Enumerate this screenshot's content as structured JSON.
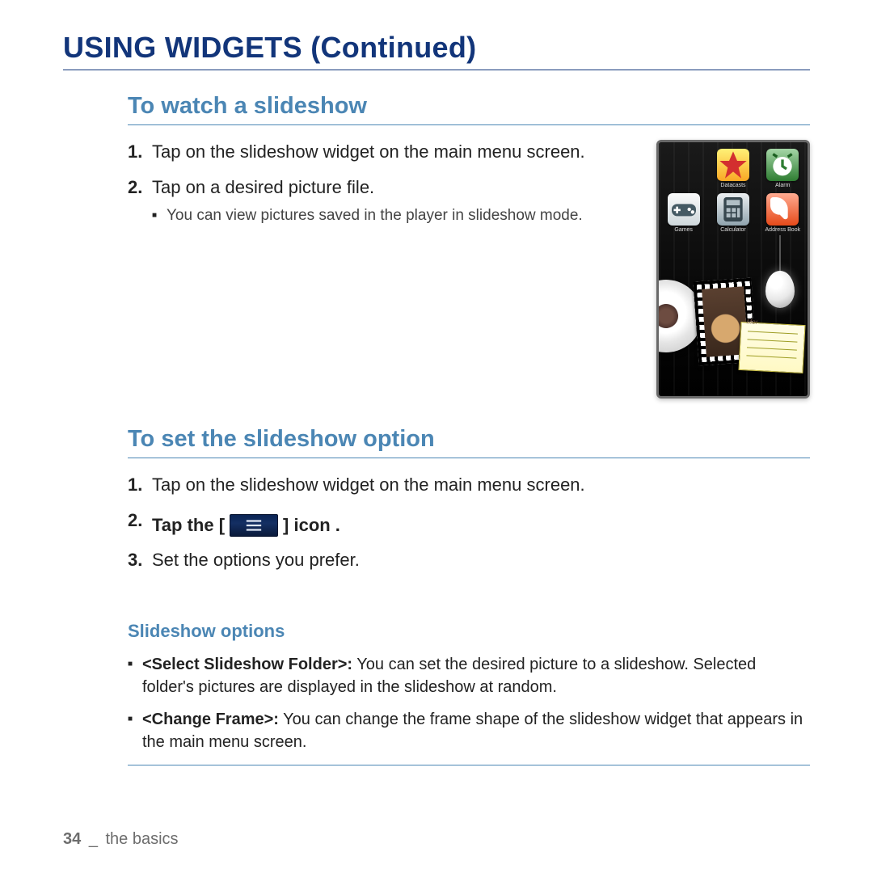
{
  "page_title": "USING WIDGETS (Continued)",
  "section1": {
    "title": "To watch a slideshow",
    "steps": [
      {
        "text": "Tap on the slideshow widget on the main menu screen."
      },
      {
        "text": "Tap on a desired picture file.",
        "sub": [
          "You can view pictures saved in the player in slideshow mode."
        ]
      }
    ]
  },
  "device": {
    "apps": [
      {
        "id": "star",
        "label": "Datacasts"
      },
      {
        "id": "alarm",
        "label": "Alarm"
      },
      {
        "id": "games",
        "label": "Games"
      },
      {
        "id": "calc",
        "label": "Calculator"
      },
      {
        "id": "book",
        "label": "Address Book"
      }
    ],
    "note_tag": "Mer"
  },
  "section2": {
    "title": "To set the slideshow option",
    "steps": [
      {
        "text": "Tap on the slideshow widget on the main menu screen."
      },
      {
        "before": "Tap the [",
        "after": "] icon",
        "icon": "menu-icon"
      },
      {
        "text": "Set the options you prefer."
      }
    ]
  },
  "options_section": {
    "title": "Slideshow options",
    "items": [
      {
        "name": "<Select Slideshow Folder>:",
        "desc": " You can set the desired picture to a slideshow. Selected folder's pictures are displayed in the slideshow at random."
      },
      {
        "name": "<Change Frame>:",
        "desc": "  You can change the frame shape of the slideshow widget that appears in the main menu screen."
      }
    ]
  },
  "footer": {
    "page": "34",
    "sep": "_",
    "label": "the basics"
  }
}
